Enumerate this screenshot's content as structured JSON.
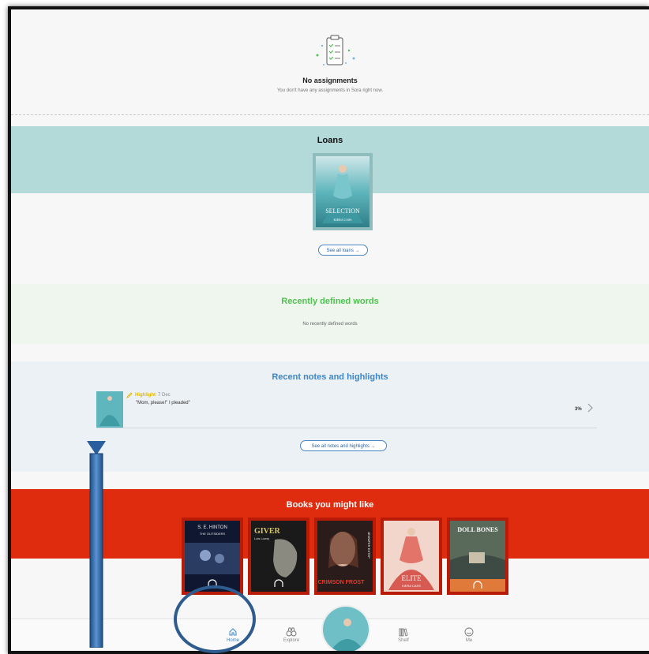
{
  "assignments": {
    "title": "No assignments",
    "subtitle": "You don't have any assignments in Sora right now."
  },
  "loans": {
    "title": "Loans",
    "see_all": "See all loans →"
  },
  "words": {
    "title": "Recently defined words",
    "empty": "No recently defined words"
  },
  "notes": {
    "title": "Recent notes and highlights",
    "item": {
      "type": "Highlight",
      "date": "7 Dec",
      "quote": "\"Mom, please!\" I pleaded\"",
      "progress": "3%"
    },
    "see_all": "See all notes and highlights →"
  },
  "recommendations": {
    "title": "Books you might like",
    "books": [
      {
        "author": "S. E. HINTON",
        "title": "THE OUTSIDERS",
        "audio": true
      },
      {
        "author": "Lois Lowry",
        "title": "GIVER",
        "audio": true
      },
      {
        "author": "JENNIFER ESTEP",
        "title": "CRIMSON FROST",
        "audio": false
      },
      {
        "author": "KIERA CASS",
        "title": "ELITE",
        "audio": false
      },
      {
        "author": "",
        "title": "DOLL BONES",
        "audio": true
      }
    ]
  },
  "nav": {
    "items": [
      {
        "label": "Home"
      },
      {
        "label": "Explore"
      },
      {
        "label": "Shelf"
      },
      {
        "label": "Me"
      }
    ]
  },
  "colors": {
    "loans_band": "#b3d9d9",
    "words_title": "#4fc24f",
    "notes_title": "#3b86c9",
    "rec_band": "#e02c0e",
    "highlight": "#e5b800"
  }
}
